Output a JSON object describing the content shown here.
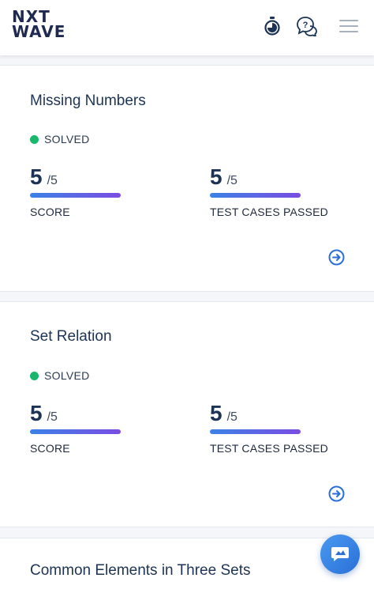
{
  "brand": {
    "logo_line1": "NXT",
    "logo_line2": "WAVE"
  },
  "header": {
    "icons": [
      "stopwatch-icon",
      "help-chat-icon",
      "hamburger-menu-icon"
    ]
  },
  "problems": [
    {
      "title": "Missing Numbers",
      "status": "SOLVED",
      "score": {
        "value": "5",
        "total": "/5",
        "label": "SCORE",
        "progress": 1.0
      },
      "tests": {
        "value": "5",
        "total": "/5",
        "label": "TEST CASES PASSED",
        "progress": 1.0
      }
    },
    {
      "title": "Set Relation",
      "status": "SOLVED",
      "score": {
        "value": "5",
        "total": "/5",
        "label": "SCORE",
        "progress": 1.0
      },
      "tests": {
        "value": "5",
        "total": "/5",
        "label": "TEST CASES PASSED",
        "progress": 1.0
      }
    },
    {
      "title": "Common Elements in Three Sets"
    }
  ],
  "colors": {
    "solved": "#18b76b",
    "progress_start": "#3b82e6",
    "progress_end": "#7b4ce3",
    "title": "#1c3355",
    "accent": "#2a6fd8"
  }
}
